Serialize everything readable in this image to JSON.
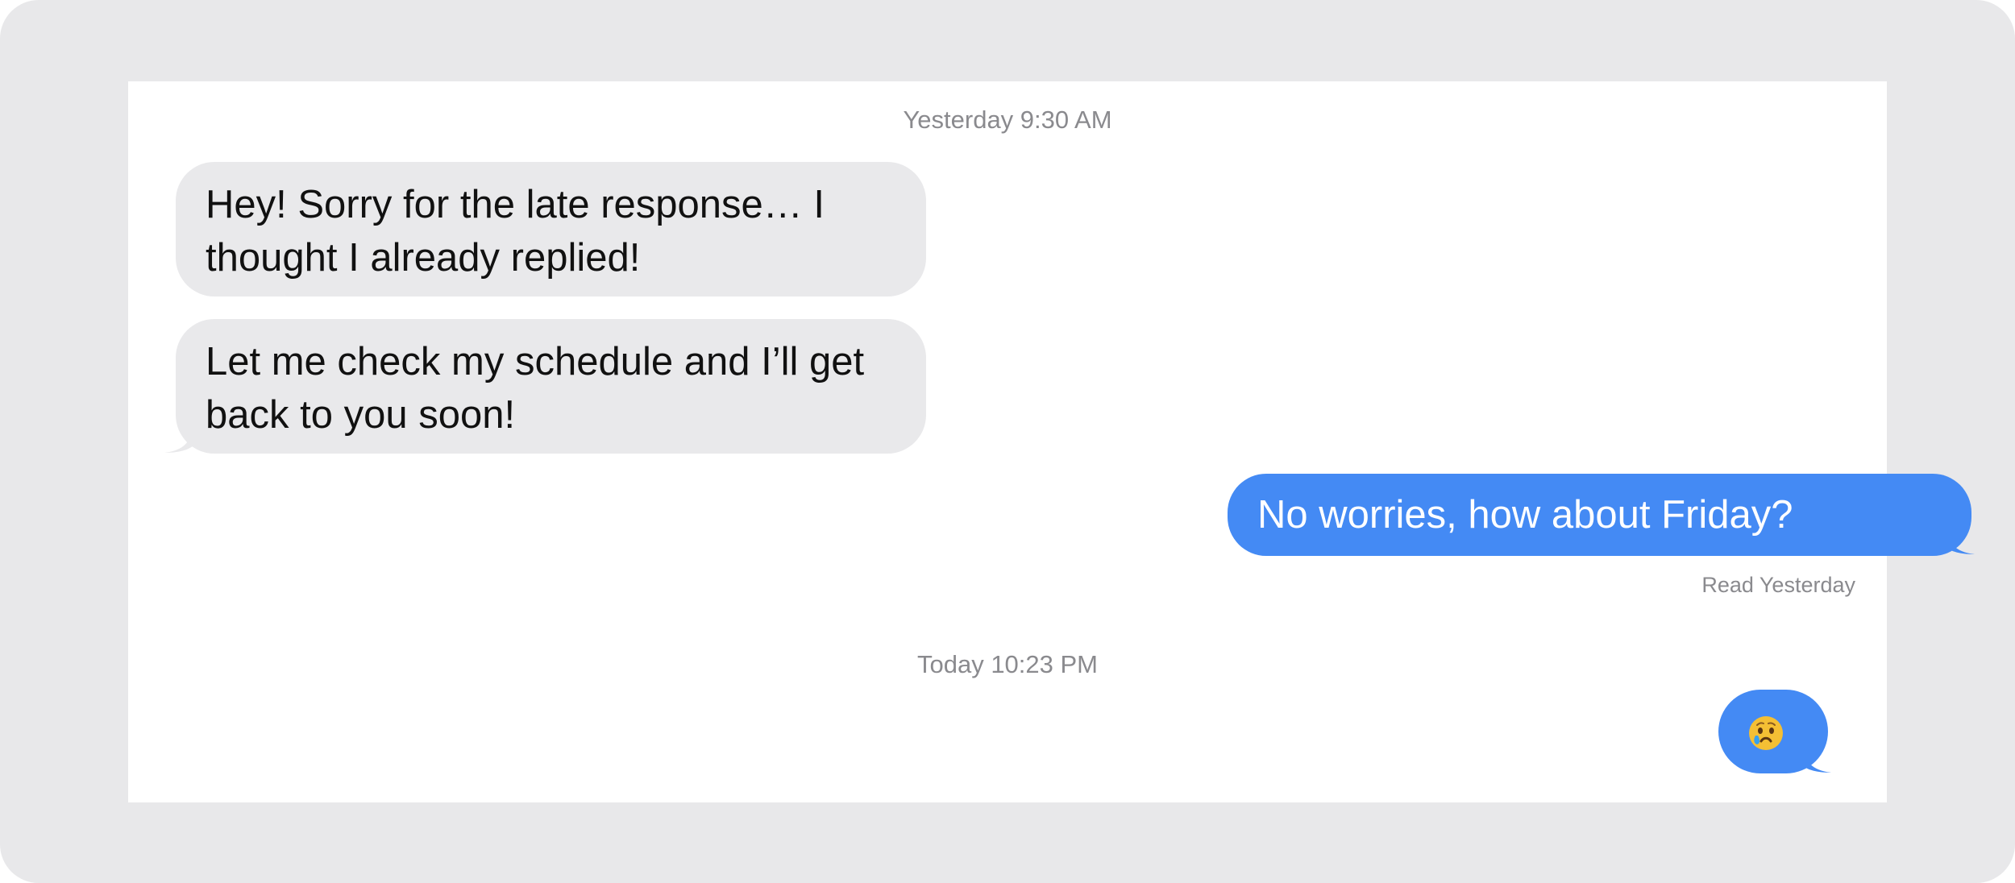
{
  "conversation": {
    "sections": [
      {
        "timestamp": "Yesterday 9:30 AM"
      },
      {
        "timestamp": "Today 10:23 PM"
      }
    ],
    "messages": [
      {
        "sender": "incoming",
        "text": "Hey! Sorry for the late response… I thought I already replied!"
      },
      {
        "sender": "incoming",
        "text": "Let me check my schedule and I’ll get back to you soon!"
      },
      {
        "sender": "outgoing",
        "text": "No worries, how about Friday?"
      },
      {
        "sender": "outgoing",
        "emoji": "crying-face-icon"
      }
    ],
    "read_receipt": "Read Yesterday"
  },
  "colors": {
    "outer_background": "#e8e8ea",
    "card_background": "#ffffff",
    "incoming_bubble": "#e9e9eb",
    "outgoing_bubble": "#448af4",
    "meta_text": "#8a8a8e"
  }
}
